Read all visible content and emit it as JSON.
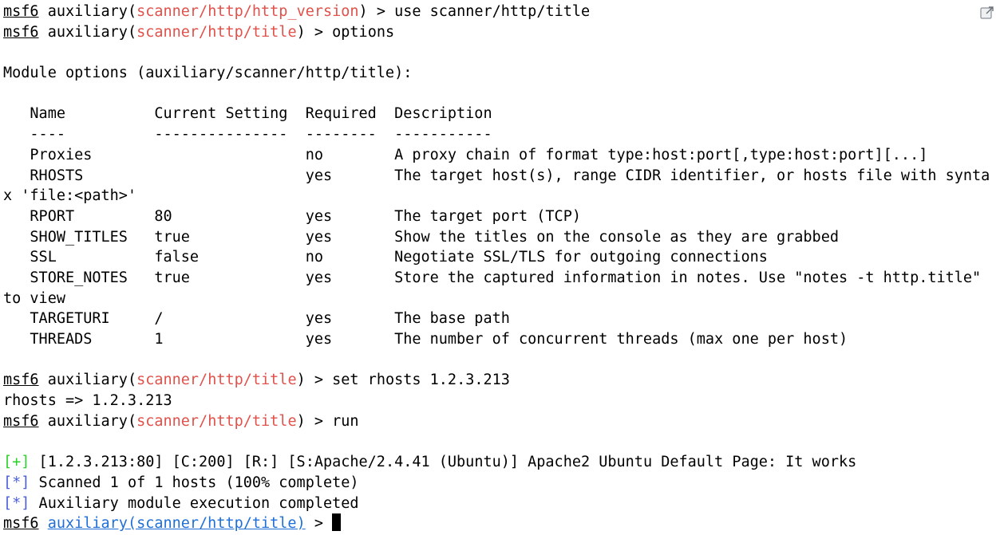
{
  "prompt": {
    "prefix": "msf6",
    "module_word": "auxiliary",
    "open": "(",
    "close": ")",
    "arrow": " > "
  },
  "lines": {
    "l1_module": "scanner/http/http_version",
    "l1_cmd": "use scanner/http/title",
    "l2_module": "scanner/http/title",
    "l2_cmd": "options",
    "module_options_header": "Module options (auxiliary/scanner/http/title):",
    "table_header": "   Name          Current Setting  Required  Description",
    "table_rule": "   ----          ---------------  --------  -----------",
    "table_rows": [
      "   Proxies                        no        A proxy chain of format type:host:port[,type:host:port][...]",
      "   RHOSTS                         yes       The target host(s), range CIDR identifier, or hosts file with synta",
      "x 'file:<path>'",
      "   RPORT         80               yes       The target port (TCP)",
      "   SHOW_TITLES   true             yes       Show the titles on the console as they are grabbed",
      "   SSL           false            no        Negotiate SSL/TLS for outgoing connections",
      "   STORE_NOTES   true             yes       Store the captured information in notes. Use \"notes -t http.title\"",
      "to view",
      "   TARGETURI     /                yes       The base path",
      "   THREADS       1                yes       The number of concurrent threads (max one per host)"
    ],
    "l3_module": "scanner/http/title",
    "l3_cmd": "set rhosts 1.2.3.213",
    "rhosts_echo": "rhosts => 1.2.3.213",
    "l4_module": "scanner/http/title",
    "l4_cmd": "run",
    "status_lines": [
      {
        "tag": "[+]",
        "text": " [1.2.3.213:80] [C:200] [R:] [S:Apache/2.4.41 (Ubuntu)] Apache2 Ubuntu Default Page: It works",
        "color": "#2bd12b"
      },
      {
        "tag": "[*]",
        "text": " Scanned 1 of 1 hosts (100% complete)",
        "color": "#4b5ed8"
      },
      {
        "tag": "[*]",
        "text": " Auxiliary module execution completed",
        "color": "#4b5ed8"
      }
    ],
    "final_module_link": "auxiliary(scanner/http/title)",
    "final_suffix": " > "
  },
  "colors": {
    "module_name": "#e0524b",
    "success_tag": "#2bd12b",
    "info_tag": "#4b5ed8",
    "link": "#1f6fd6"
  },
  "icons": {
    "corner": "external-window-icon"
  }
}
